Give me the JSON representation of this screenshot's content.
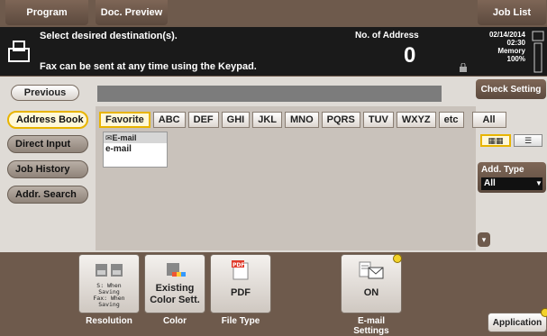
{
  "top_tabs": {
    "program": "Program",
    "doc_preview": "Doc. Preview",
    "job_list": "Job List"
  },
  "status": {
    "message_line1": "Select desired destination(s).",
    "message_line2": "Fax can be sent at any time using the Keypad.",
    "no_of_address_label": "No. of Address",
    "address_count": "0",
    "date": "02/14/2014",
    "time": "02:30",
    "memory_label": "Memory",
    "memory_value": "100%"
  },
  "nav": {
    "previous": "Previous",
    "check_setting": "Check Setting",
    "left_menu": [
      "Address Book",
      "Direct Input",
      "Job History",
      "Addr. Search"
    ]
  },
  "index_tabs": [
    "Favorite",
    "ABC",
    "DEF",
    "GHI",
    "JKL",
    "MNO",
    "PQRS",
    "TUV",
    "WXYZ",
    "etc",
    "All"
  ],
  "result": {
    "header": "E-mail",
    "value": "e-mail"
  },
  "add_type": {
    "label": "Add. Type",
    "selected": "All"
  },
  "tiles": [
    {
      "label": "Resolution",
      "value_lines": [
        "S: When",
        "Saving",
        "Fax: When",
        "Saving"
      ],
      "icon": "resolution-icon"
    },
    {
      "label": "Color",
      "value": "Existing Color Sett.",
      "icon": "color-icon"
    },
    {
      "label": "File Type",
      "value": "PDF",
      "icon": "pdf-icon",
      "icon_text": "PDF"
    },
    {
      "label": "E-mail Settings",
      "value": "ON",
      "icon": "email-settings-icon"
    }
  ],
  "application": "Application",
  "colors": {
    "accent": "#e8b400",
    "frame": "#6e5a4c",
    "panel": "#dfdbd6",
    "status_bg": "#1a1a1a"
  }
}
